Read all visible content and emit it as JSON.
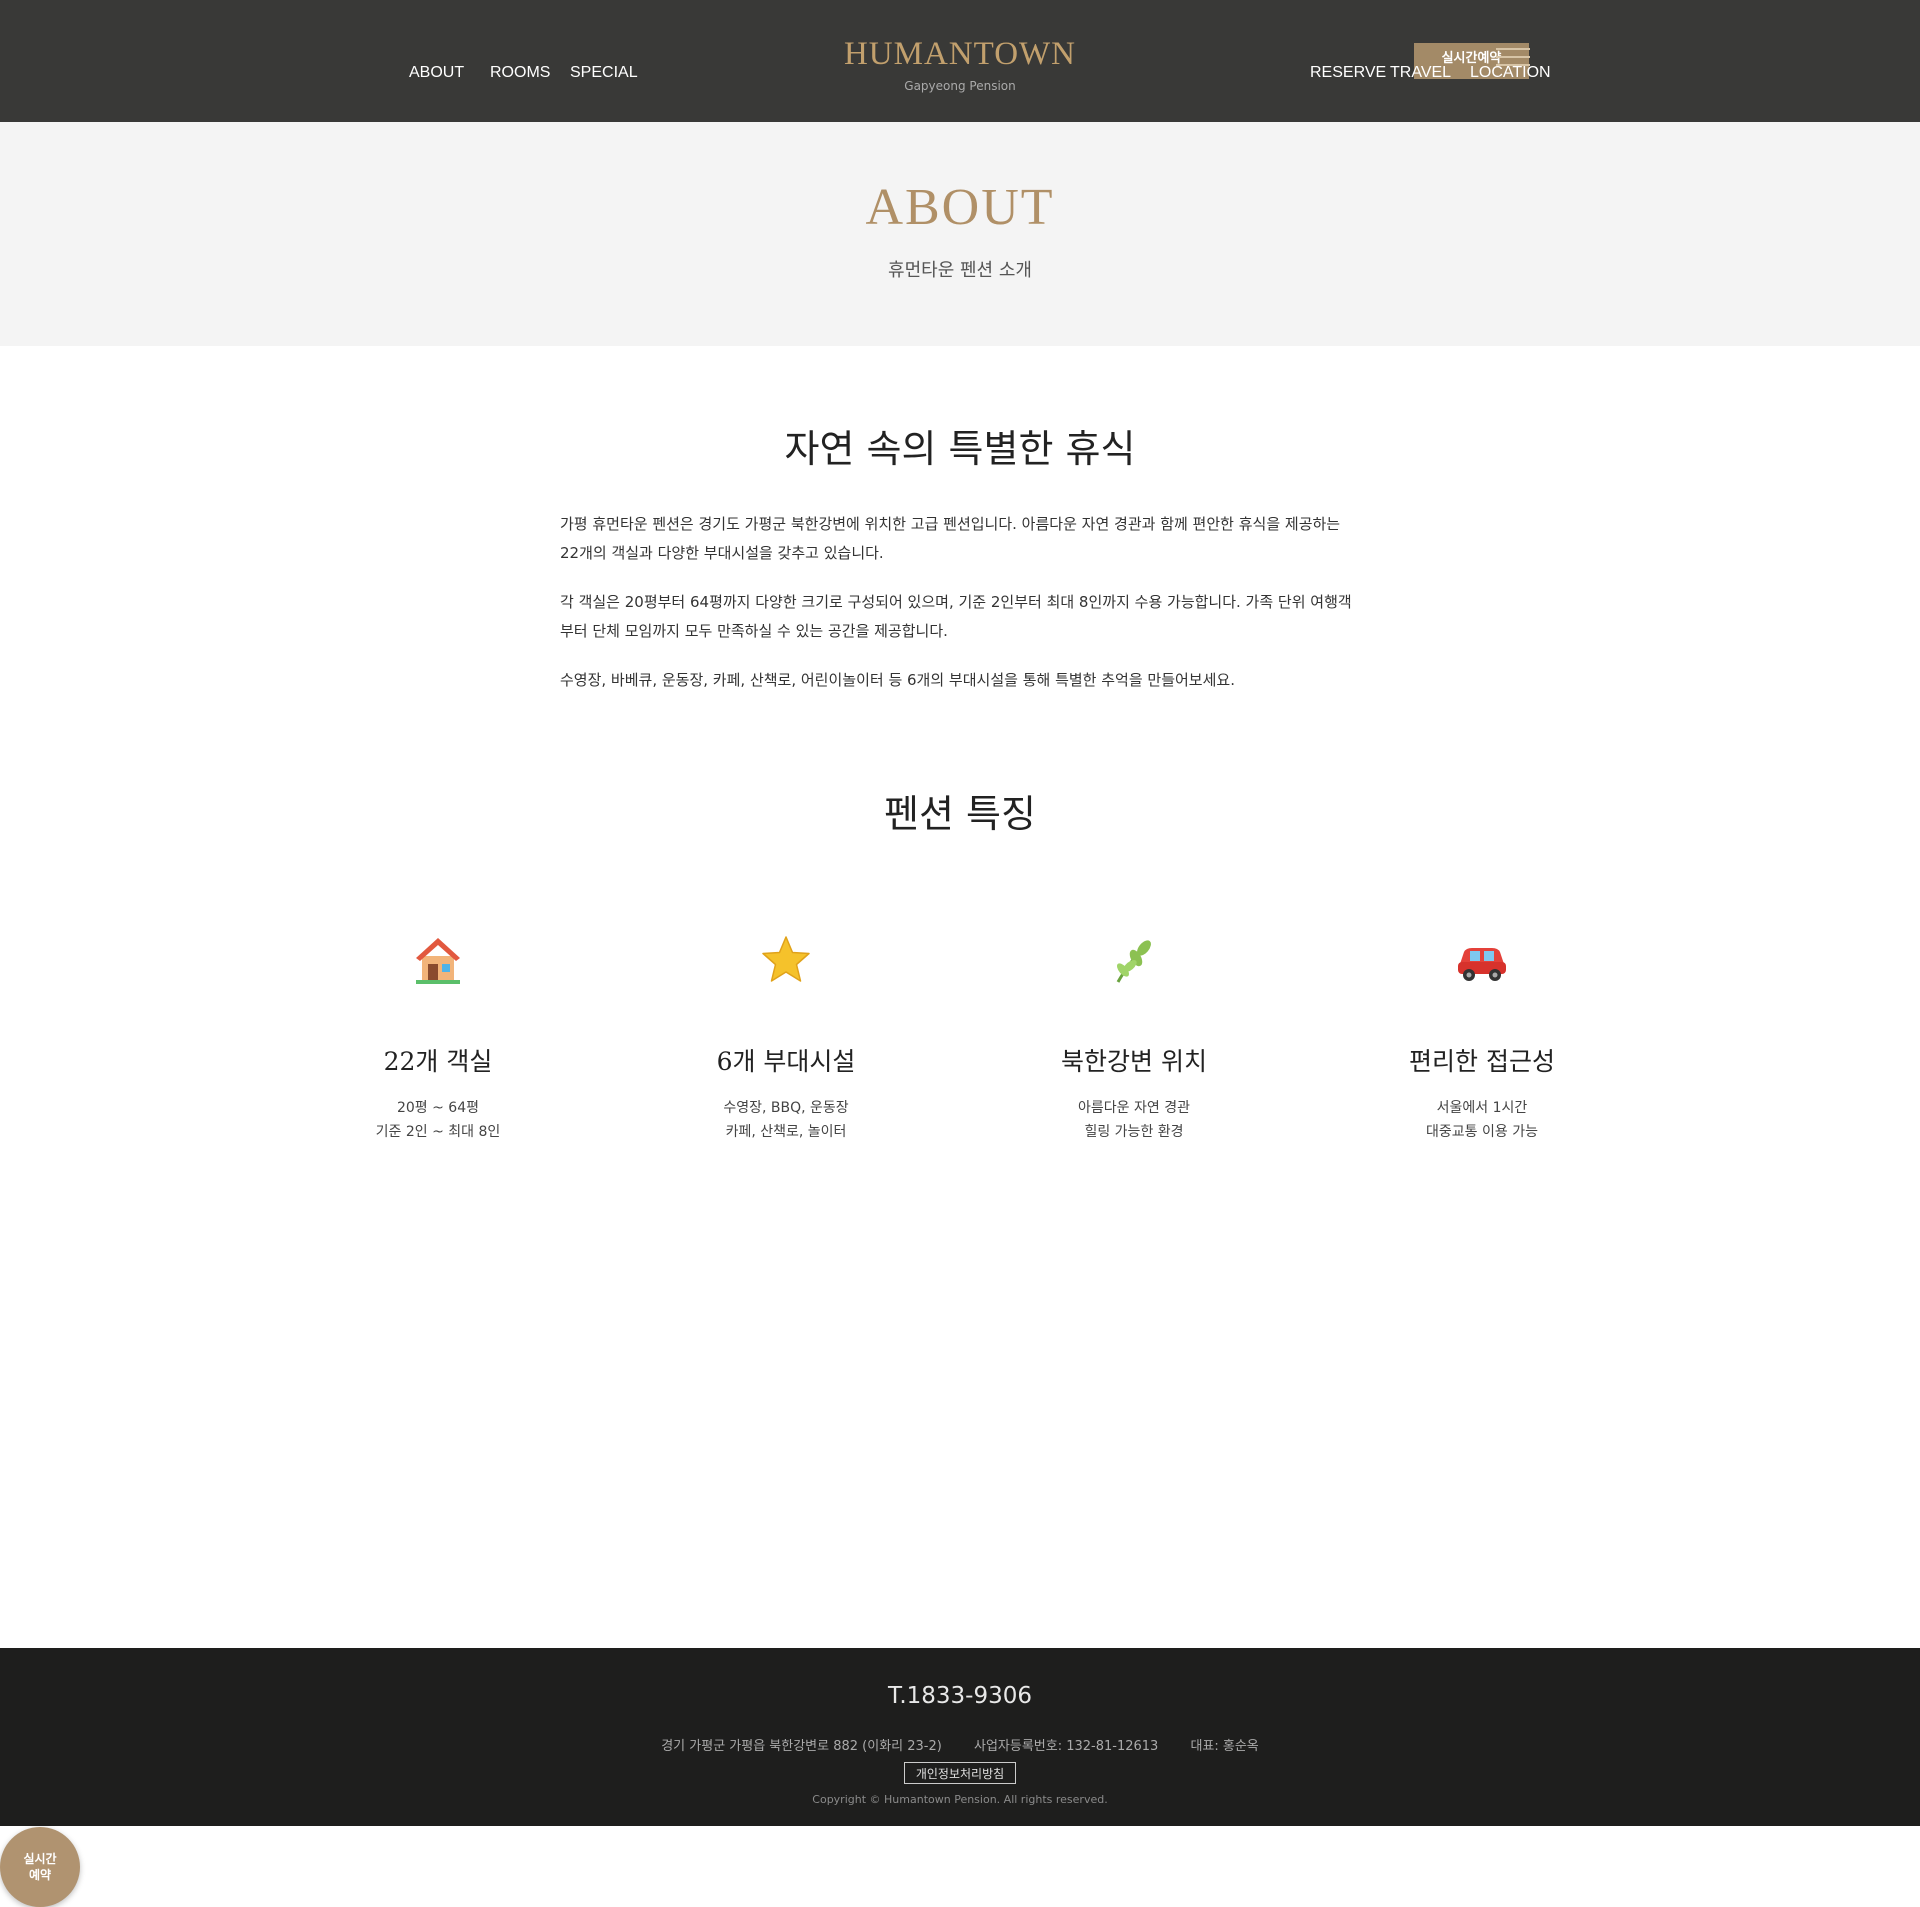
{
  "header": {
    "nav_left": [
      "ABOUT",
      "ROOMS",
      "SPECIAL"
    ],
    "logo": "HUMANTOWN",
    "logo_sub": "Gapyeong Pension",
    "nav_right": [
      "RESERVE",
      "TRAVEL",
      "LOCATION"
    ],
    "reserve_button": "실시간예약",
    "menu_icon": "hamburger-icon"
  },
  "hero": {
    "title": "ABOUT",
    "subtitle": "휴먼타운 펜션 소개"
  },
  "intro": {
    "title": "자연 속의 특별한 휴식",
    "paragraphs": [
      "가평 휴먼타운 펜션은 경기도 가평군 북한강변에 위치한 고급 펜션입니다. 아름다운 자연 경관과 함께 편안한 휴식을 제공하는 22개의 객실과 다양한 부대시설을 갖추고 있습니다.",
      "각 객실은 20평부터 64평까지 다양한 크기로 구성되어 있으며, 기준 2인부터 최대 8인까지 수용 가능합니다. 가족 단위 여행객부터 단체 모임까지 모두 만족하실 수 있는 공간을 제공합니다.",
      "수영장, 바베큐, 운동장, 카페, 산책로, 어린이놀이터 등 6개의 부대시설을 통해 특별한 추억을 만들어보세요."
    ]
  },
  "features": {
    "title": "펜션 특징",
    "items": [
      {
        "icon": "house-icon",
        "title": "22개 객실",
        "line1": "20평 ~ 64평",
        "line2": "기준 2인 ~ 최대 8인"
      },
      {
        "icon": "star-icon",
        "title": "6개 부대시설",
        "line1": "수영장, BBQ, 운동장",
        "line2": "카페, 산책로, 놀이터"
      },
      {
        "icon": "herb-icon",
        "title": "북한강변 위치",
        "line1": "아름다운 자연 경관",
        "line2": "힐링 가능한 환경"
      },
      {
        "icon": "car-icon",
        "title": "편리한 접근성",
        "line1": "서울에서 1시간",
        "line2": "대중교통 이용 가능"
      }
    ]
  },
  "footer": {
    "phone": "T.1833-9306",
    "address": "경기 가평군 가평읍 북한강변로 882 (이화리 23-2)",
    "business_number": "사업자등록번호: 132-81-12613",
    "representative": "대표: 홍순옥",
    "privacy": "개인정보처리방침",
    "copyright": "Copyright © Humantown Pension. All rights reserved."
  },
  "fab": {
    "line1": "실시간",
    "line2": "예약"
  },
  "colors": {
    "header_bg": "#393937",
    "accent_gold": "#c2a06d",
    "hero_bg": "#f4f4f4",
    "footer_bg": "#1e1e1d",
    "reserve_btn": "#a38a67"
  }
}
